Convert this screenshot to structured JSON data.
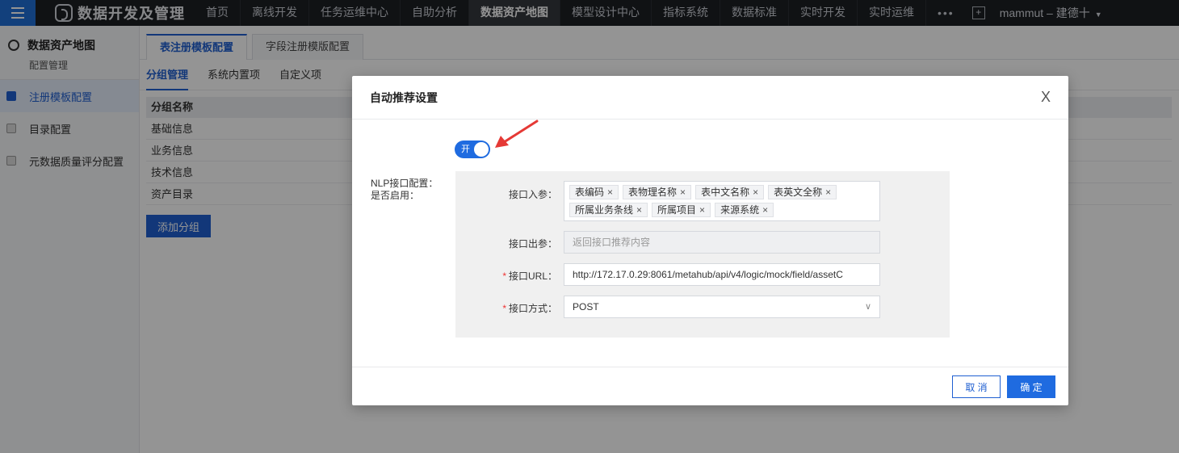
{
  "topbar": {
    "app_title": "数据开发及管理",
    "nav": [
      "首页",
      "离线开发",
      "任务运维中心",
      "自助分析",
      "数据资产地图",
      "模型设计中心",
      "指标系统",
      "数据标准",
      "实时开发",
      "实时运维"
    ],
    "active_nav_index": 4,
    "more": "•••",
    "plus": "+",
    "user": "mammut – 建德十"
  },
  "sidebar": {
    "title": "数据资产地图",
    "subtitle": "配置管理",
    "items": [
      {
        "label": "注册模板配置",
        "active": true
      },
      {
        "label": "目录配置",
        "active": false
      },
      {
        "label": "元数据质量评分配置",
        "active": false
      }
    ]
  },
  "main": {
    "tabs": [
      "表注册模板配置",
      "字段注册模版配置"
    ],
    "subtabs": [
      "分组管理",
      "系统内置项",
      "自定义项"
    ],
    "grid_header": "分组名称",
    "grid_rows": [
      "基础信息",
      "业务信息",
      "技术信息",
      "资产目录"
    ],
    "add_button": "添加分组"
  },
  "dialog": {
    "title": "自动推荐设置",
    "close": "X",
    "enable_label": "是否启用：",
    "switch_text": "开",
    "nlp_label": "NLP接口配置：",
    "input_params_label": "接口入参：",
    "input_params": [
      "表编码",
      "表物理名称",
      "表中文名称",
      "表英文全称",
      "所属业务条线",
      "所属项目",
      "来源系统"
    ],
    "output_label": "接口出参：",
    "output_placeholder": "返回接口推荐内容",
    "url_label": "接口URL：",
    "url_value": "http://172.17.0.29:8061/metahub/api/v4/logic/mock/field/assetC",
    "method_label": "接口方式：",
    "method_value": "POST",
    "cancel": "取 消",
    "ok": "确 定"
  },
  "colors": {
    "accent": "#1f5fd1",
    "switch_on": "#1f6be0",
    "topbar": "#1d1f24",
    "arrow": "#e53935"
  }
}
